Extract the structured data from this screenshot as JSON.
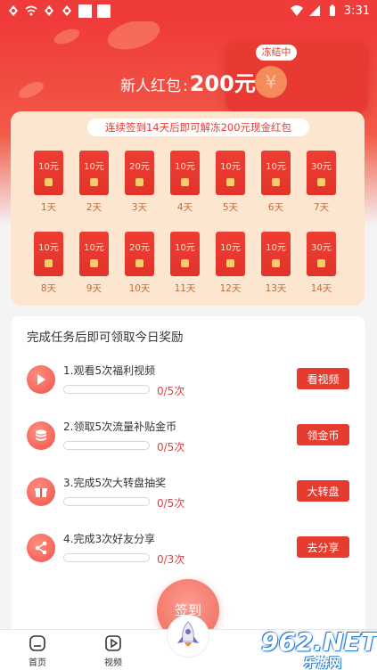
{
  "status_bar": {
    "time": "3:31",
    "colors": {
      "background": "#ef3b3a"
    }
  },
  "header": {
    "bonus_label": "新人红包",
    "bonus_separator": ":",
    "bonus_value": "200元",
    "frozen_badge": "冻结中",
    "coin_symbol": "¥"
  },
  "checkin": {
    "banner": "连续签到14天后即可解冻200元现金红包",
    "days": [
      {
        "amount": "10元",
        "label": "1天"
      },
      {
        "amount": "10元",
        "label": "2天"
      },
      {
        "amount": "20元",
        "label": "3天"
      },
      {
        "amount": "10元",
        "label": "4天"
      },
      {
        "amount": "10元",
        "label": "5天"
      },
      {
        "amount": "10元",
        "label": "6天"
      },
      {
        "amount": "30元",
        "label": "7天"
      },
      {
        "amount": "10元",
        "label": "8天"
      },
      {
        "amount": "10元",
        "label": "9天"
      },
      {
        "amount": "20元",
        "label": "10天"
      },
      {
        "amount": "10元",
        "label": "11天"
      },
      {
        "amount": "10元",
        "label": "12天"
      },
      {
        "amount": "10元",
        "label": "13天"
      },
      {
        "amount": "30元",
        "label": "14天"
      }
    ]
  },
  "tasks": {
    "title": "完成任务后即可领取今日奖励",
    "items": [
      {
        "text": "1.观看5次福利视频",
        "count": "0/5次",
        "progress": 0,
        "button": "看视频",
        "icon": "play-icon"
      },
      {
        "text": "2.领取5次流量补贴金币",
        "count": "0/5次",
        "progress": 0,
        "button": "领金币",
        "icon": "coins-icon"
      },
      {
        "text": "3.完成5次大转盘抽奖",
        "count": "0/5次",
        "progress": 0,
        "button": "大转盘",
        "icon": "gift-icon"
      },
      {
        "text": "4.完成3次好友分享",
        "count": "0/3次",
        "progress": 0,
        "button": "去分享",
        "icon": "share-icon"
      }
    ]
  },
  "signin_button": "签到",
  "bottom_nav": {
    "items": [
      {
        "label": "首页",
        "icon": "home-icon"
      },
      {
        "label": "视频",
        "icon": "video-icon"
      }
    ],
    "center_icon": "rocket-icon"
  },
  "watermark": {
    "brand": "962.NET",
    "sub": "乐游网"
  },
  "colors": {
    "accent": "#e63b2f",
    "panel": "#fde6cf",
    "packet": "#ee3d33"
  }
}
